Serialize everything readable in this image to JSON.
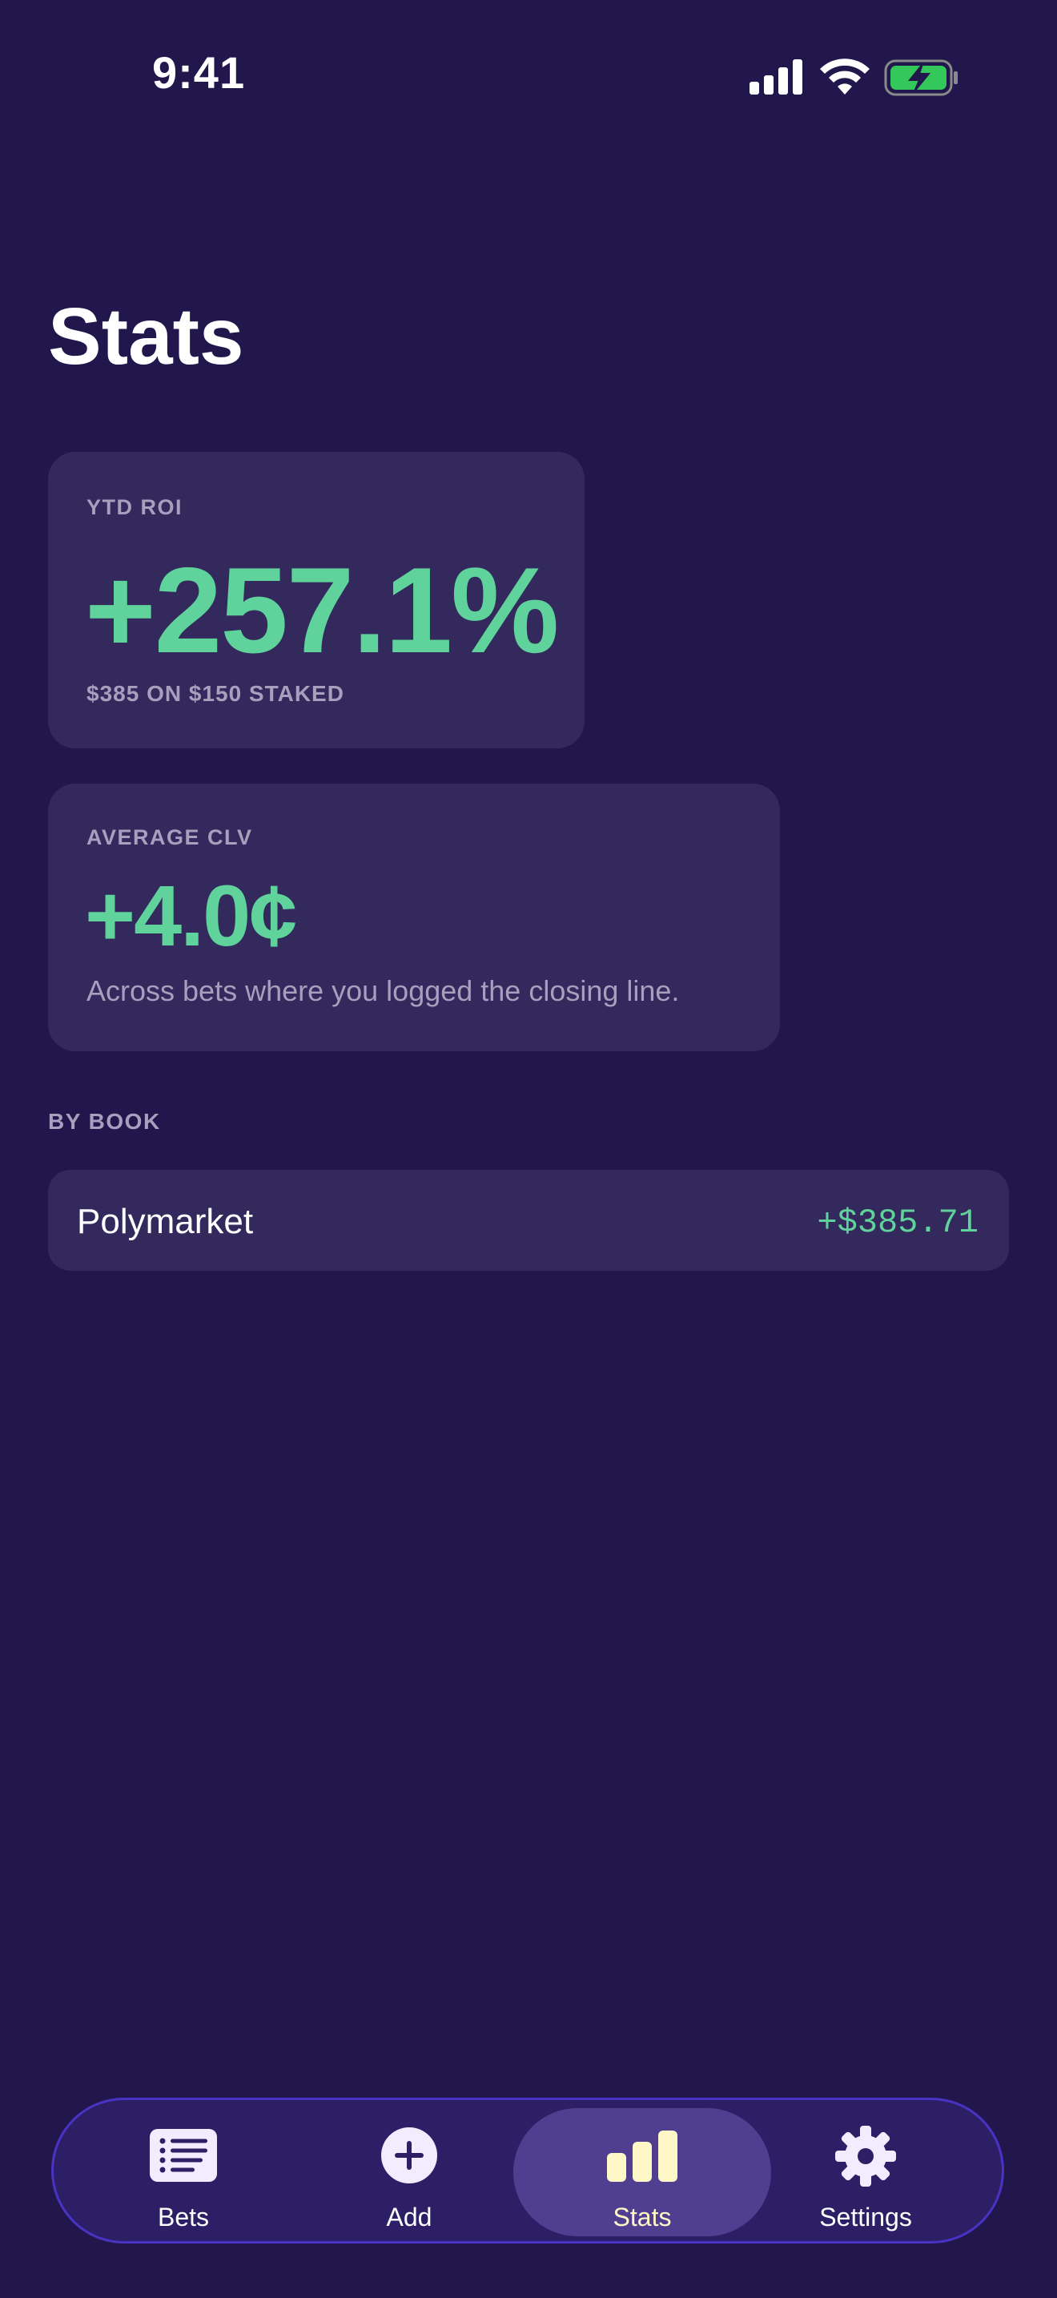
{
  "status_bar": {
    "time": "9:41"
  },
  "page": {
    "title": "Stats"
  },
  "roi_card": {
    "label": "YTD ROI",
    "value": "+257.1%",
    "subtitle": "$385 ON $150 STAKED"
  },
  "clv_card": {
    "label": "AVERAGE CLV",
    "value": "+4.0¢",
    "description": "Across bets where you logged the closing line."
  },
  "by_book": {
    "header": "BY BOOK",
    "rows": [
      {
        "name": "Polymarket",
        "amount": "+$385.71"
      }
    ]
  },
  "tab_bar": {
    "tabs": [
      {
        "label": "Bets",
        "icon": "list-icon"
      },
      {
        "label": "Add",
        "icon": "plus-circle-icon"
      },
      {
        "label": "Stats",
        "icon": "bar-chart-icon",
        "selected": true
      },
      {
        "label": "Settings",
        "icon": "gear-icon"
      }
    ]
  },
  "colors": {
    "background": "#22174d",
    "card": "#33295c",
    "positive": "#5fd39b",
    "muted": "#a89fbe",
    "tab_selected_bg": "#503f91",
    "tab_selected_fg": "#fff7c8",
    "tab_bar_border": "#4a33c4"
  }
}
